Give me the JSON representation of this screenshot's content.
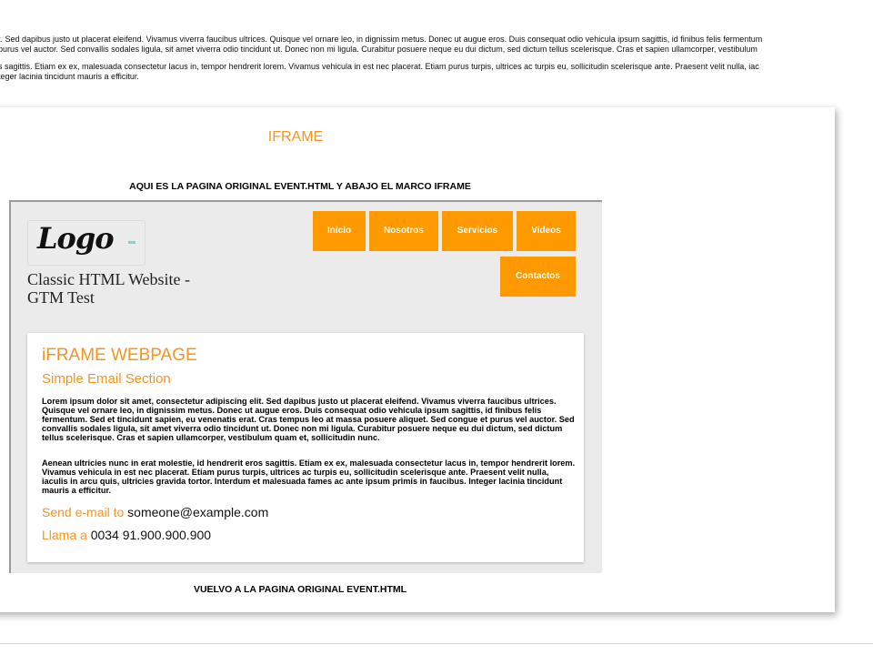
{
  "intro": {
    "line1": "t. Sed dapibus justo ut placerat eleifend. Vivamus viverra faucibus ultrices. Quisque vel ornare leo, in dignissim metus. Donec ut augue eros. Duis consequat odio vehicula ipsum sagittis, id finibus felis fermentum",
    "line2": "purus vel auctor. Sed convallis sodales ligula, sit amet viverra odio tincidunt ut. Donec non mi ligula. Curabitur posuere neque eu dui dictum, sed dictum tellus scelerisque. Cras et sapien ullamcorper, vestibulum",
    "line3": "s sagittis. Etiam ex ex, malesuada consectetur lacus in, tempor hendrerit lorem. Vivamus vehicula in est nec placerat. Etiam purus turpis, ultrices ac turpis eu, sollicitudin scelerisque ante. Praesent velit nulla, iac",
    "line4": "teger lacinia tincidunt mauris a efficitur."
  },
  "card": {
    "iframe_title": "IFRAME",
    "caption_top": "AQUI ES LA PAGINA ORIGINAL EVENT.HTML Y ABAJO EL MARCO IFRAME",
    "caption_bottom": "VUELVO A LA PAGINA ORIGINAL EVENT.HTML"
  },
  "frame": {
    "logo_text": "Logo",
    "site_title": "Classic HTML Website - GTM Test",
    "nav": [
      "Inicio",
      "Nosotros",
      "Servicios",
      "Videos",
      "Contactos"
    ],
    "content": {
      "heading": "iFRAME WEBPAGE",
      "subheading": "Simple Email Section",
      "paragraph1": "Lorem ipsum dolor sit amet, consectetur adipiscing elit. Sed dapibus justo ut placerat eleifend. Vivamus viverra faucibus ultrices. Quisque vel ornare leo, in dignissim metus. Donec ut augue eros. Duis consequat odio vehicula ipsum sagittis, id finibus felis fermentum. Sed et tincidunt sapien, eu venenatis erat. Cras tempus leo at massa posuere aliquet. Sed congue et purus vel auctor. Sed convallis sodales ligula, sit amet viverra odio tincidunt ut. Donec non mi ligula. Curabitur posuere neque eu dui dictum, sed dictum tellus scelerisque. Cras et sapien ullamcorper, vestibulum quam et, sollicitudin nunc.",
      "paragraph2": "Aenean ultricies nunc in erat molestie, id hendrerit eros sagittis. Etiam ex ex, malesuada consectetur lacus in, tempor hendrerit lorem. Vivamus vehicula in est nec placerat. Etiam purus turpis, ultrices ac turpis eu, sollicitudin scelerisque ante. Praesent velit nulla, iaculis in arcu quis, ultricies gravida tortor. Interdum et malesuada fames ac ante ipsum primis in faucibus. Integer lacinia tincidunt mauris a efficitur.",
      "email_label": "Send e-mail to ",
      "email_value": "someone@example.com",
      "phone_label": "Llama a ",
      "phone_value": "0034 91.900.900.900"
    }
  },
  "colors": {
    "accent": "#f7941d",
    "nav_bg": "#ff9900",
    "frame_bg": "#ebebeb"
  }
}
